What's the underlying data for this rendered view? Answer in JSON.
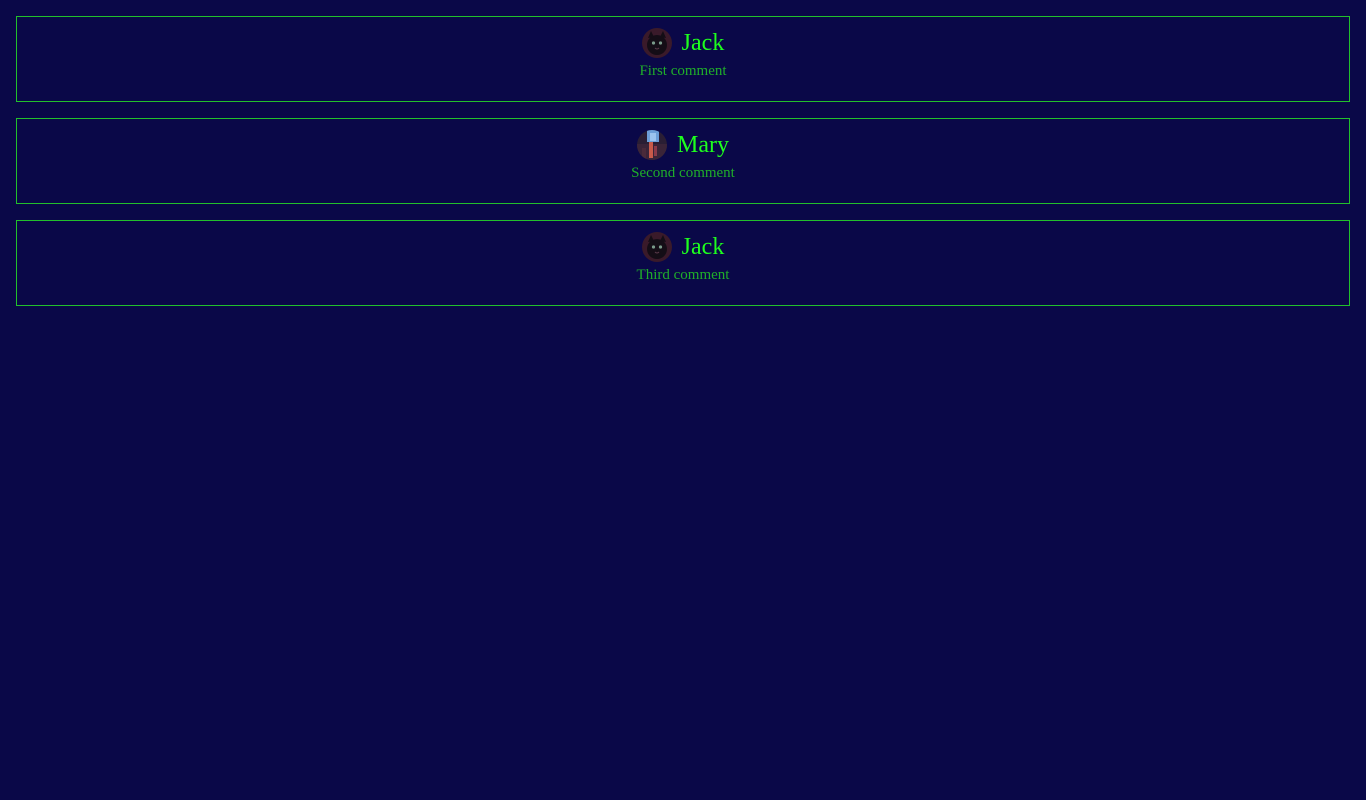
{
  "comments": [
    {
      "author": "Jack",
      "avatar_icon": "black-cat-avatar",
      "text": "First comment"
    },
    {
      "author": "Mary",
      "avatar_icon": "night-city-avatar",
      "text": "Second comment"
    },
    {
      "author": "Jack",
      "avatar_icon": "black-cat-avatar",
      "text": "Third comment"
    }
  ],
  "colors": {
    "background": "#0a0848",
    "border": "#22c02c",
    "author": "#1eff1e",
    "comment_text": "#1fae2a"
  }
}
